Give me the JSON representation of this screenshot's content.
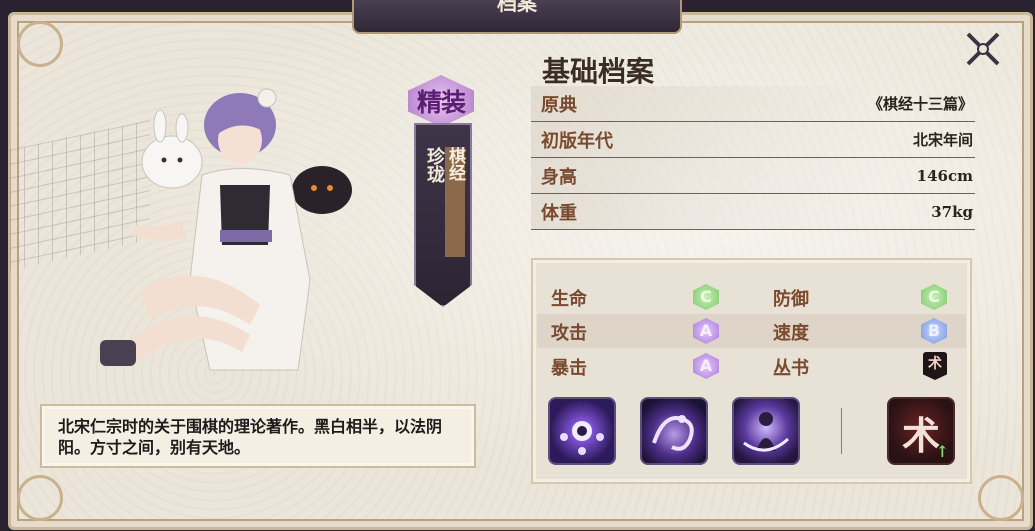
{
  "header": {
    "title": "档案"
  },
  "badge": {
    "tier": "精装",
    "rarity": "珍珑",
    "type": "棋经"
  },
  "description": "北宋仁宗时的关于围棋的理论著作。黑白相半，以法阴阳。方寸之间，别有天地。",
  "info": {
    "title": "基础档案",
    "rows": [
      {
        "label": "原典",
        "value": "《棋经十三篇》"
      },
      {
        "label": "初版年代",
        "value": "北宋年间"
      },
      {
        "label": "身高",
        "value": "146cm"
      },
      {
        "label": "体重",
        "value": "37kg"
      }
    ]
  },
  "stats": {
    "hp": {
      "label": "生命",
      "grade": "C"
    },
    "defense": {
      "label": "防御",
      "grade": "C"
    },
    "attack": {
      "label": "攻击",
      "grade": "A"
    },
    "speed": {
      "label": "速度",
      "grade": "B"
    },
    "crit": {
      "label": "暴击",
      "grade": "A"
    },
    "book": {
      "label": "丛书",
      "icon_text": "术"
    }
  },
  "skill_book": {
    "icon_text": "术"
  },
  "colors": {
    "grade_c": "#79c66a",
    "grade_a": "#a77ad6",
    "grade_b": "#7a94e0",
    "label_brown": "#7a4a2e"
  }
}
